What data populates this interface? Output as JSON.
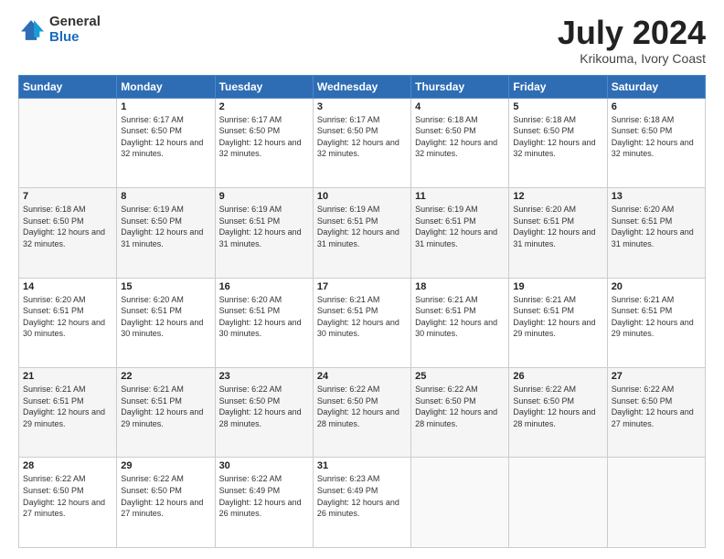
{
  "logo": {
    "general": "General",
    "blue": "Blue"
  },
  "header": {
    "month": "July 2024",
    "location": "Krikouma, Ivory Coast"
  },
  "weekdays": [
    "Sunday",
    "Monday",
    "Tuesday",
    "Wednesday",
    "Thursday",
    "Friday",
    "Saturday"
  ],
  "weeks": [
    [
      {
        "day": "",
        "sunrise": "",
        "sunset": "",
        "daylight": ""
      },
      {
        "day": "1",
        "sunrise": "Sunrise: 6:17 AM",
        "sunset": "Sunset: 6:50 PM",
        "daylight": "Daylight: 12 hours and 32 minutes."
      },
      {
        "day": "2",
        "sunrise": "Sunrise: 6:17 AM",
        "sunset": "Sunset: 6:50 PM",
        "daylight": "Daylight: 12 hours and 32 minutes."
      },
      {
        "day": "3",
        "sunrise": "Sunrise: 6:17 AM",
        "sunset": "Sunset: 6:50 PM",
        "daylight": "Daylight: 12 hours and 32 minutes."
      },
      {
        "day": "4",
        "sunrise": "Sunrise: 6:18 AM",
        "sunset": "Sunset: 6:50 PM",
        "daylight": "Daylight: 12 hours and 32 minutes."
      },
      {
        "day": "5",
        "sunrise": "Sunrise: 6:18 AM",
        "sunset": "Sunset: 6:50 PM",
        "daylight": "Daylight: 12 hours and 32 minutes."
      },
      {
        "day": "6",
        "sunrise": "Sunrise: 6:18 AM",
        "sunset": "Sunset: 6:50 PM",
        "daylight": "Daylight: 12 hours and 32 minutes."
      }
    ],
    [
      {
        "day": "7",
        "sunrise": "Sunrise: 6:18 AM",
        "sunset": "Sunset: 6:50 PM",
        "daylight": "Daylight: 12 hours and 32 minutes."
      },
      {
        "day": "8",
        "sunrise": "Sunrise: 6:19 AM",
        "sunset": "Sunset: 6:50 PM",
        "daylight": "Daylight: 12 hours and 31 minutes."
      },
      {
        "day": "9",
        "sunrise": "Sunrise: 6:19 AM",
        "sunset": "Sunset: 6:51 PM",
        "daylight": "Daylight: 12 hours and 31 minutes."
      },
      {
        "day": "10",
        "sunrise": "Sunrise: 6:19 AM",
        "sunset": "Sunset: 6:51 PM",
        "daylight": "Daylight: 12 hours and 31 minutes."
      },
      {
        "day": "11",
        "sunrise": "Sunrise: 6:19 AM",
        "sunset": "Sunset: 6:51 PM",
        "daylight": "Daylight: 12 hours and 31 minutes."
      },
      {
        "day": "12",
        "sunrise": "Sunrise: 6:20 AM",
        "sunset": "Sunset: 6:51 PM",
        "daylight": "Daylight: 12 hours and 31 minutes."
      },
      {
        "day": "13",
        "sunrise": "Sunrise: 6:20 AM",
        "sunset": "Sunset: 6:51 PM",
        "daylight": "Daylight: 12 hours and 31 minutes."
      }
    ],
    [
      {
        "day": "14",
        "sunrise": "Sunrise: 6:20 AM",
        "sunset": "Sunset: 6:51 PM",
        "daylight": "Daylight: 12 hours and 30 minutes."
      },
      {
        "day": "15",
        "sunrise": "Sunrise: 6:20 AM",
        "sunset": "Sunset: 6:51 PM",
        "daylight": "Daylight: 12 hours and 30 minutes."
      },
      {
        "day": "16",
        "sunrise": "Sunrise: 6:20 AM",
        "sunset": "Sunset: 6:51 PM",
        "daylight": "Daylight: 12 hours and 30 minutes."
      },
      {
        "day": "17",
        "sunrise": "Sunrise: 6:21 AM",
        "sunset": "Sunset: 6:51 PM",
        "daylight": "Daylight: 12 hours and 30 minutes."
      },
      {
        "day": "18",
        "sunrise": "Sunrise: 6:21 AM",
        "sunset": "Sunset: 6:51 PM",
        "daylight": "Daylight: 12 hours and 30 minutes."
      },
      {
        "day": "19",
        "sunrise": "Sunrise: 6:21 AM",
        "sunset": "Sunset: 6:51 PM",
        "daylight": "Daylight: 12 hours and 29 minutes."
      },
      {
        "day": "20",
        "sunrise": "Sunrise: 6:21 AM",
        "sunset": "Sunset: 6:51 PM",
        "daylight": "Daylight: 12 hours and 29 minutes."
      }
    ],
    [
      {
        "day": "21",
        "sunrise": "Sunrise: 6:21 AM",
        "sunset": "Sunset: 6:51 PM",
        "daylight": "Daylight: 12 hours and 29 minutes."
      },
      {
        "day": "22",
        "sunrise": "Sunrise: 6:21 AM",
        "sunset": "Sunset: 6:51 PM",
        "daylight": "Daylight: 12 hours and 29 minutes."
      },
      {
        "day": "23",
        "sunrise": "Sunrise: 6:22 AM",
        "sunset": "Sunset: 6:50 PM",
        "daylight": "Daylight: 12 hours and 28 minutes."
      },
      {
        "day": "24",
        "sunrise": "Sunrise: 6:22 AM",
        "sunset": "Sunset: 6:50 PM",
        "daylight": "Daylight: 12 hours and 28 minutes."
      },
      {
        "day": "25",
        "sunrise": "Sunrise: 6:22 AM",
        "sunset": "Sunset: 6:50 PM",
        "daylight": "Daylight: 12 hours and 28 minutes."
      },
      {
        "day": "26",
        "sunrise": "Sunrise: 6:22 AM",
        "sunset": "Sunset: 6:50 PM",
        "daylight": "Daylight: 12 hours and 28 minutes."
      },
      {
        "day": "27",
        "sunrise": "Sunrise: 6:22 AM",
        "sunset": "Sunset: 6:50 PM",
        "daylight": "Daylight: 12 hours and 27 minutes."
      }
    ],
    [
      {
        "day": "28",
        "sunrise": "Sunrise: 6:22 AM",
        "sunset": "Sunset: 6:50 PM",
        "daylight": "Daylight: 12 hours and 27 minutes."
      },
      {
        "day": "29",
        "sunrise": "Sunrise: 6:22 AM",
        "sunset": "Sunset: 6:50 PM",
        "daylight": "Daylight: 12 hours and 27 minutes."
      },
      {
        "day": "30",
        "sunrise": "Sunrise: 6:22 AM",
        "sunset": "Sunset: 6:49 PM",
        "daylight": "Daylight: 12 hours and 26 minutes."
      },
      {
        "day": "31",
        "sunrise": "Sunrise: 6:23 AM",
        "sunset": "Sunset: 6:49 PM",
        "daylight": "Daylight: 12 hours and 26 minutes."
      },
      {
        "day": "",
        "sunrise": "",
        "sunset": "",
        "daylight": ""
      },
      {
        "day": "",
        "sunrise": "",
        "sunset": "",
        "daylight": ""
      },
      {
        "day": "",
        "sunrise": "",
        "sunset": "",
        "daylight": ""
      }
    ]
  ]
}
